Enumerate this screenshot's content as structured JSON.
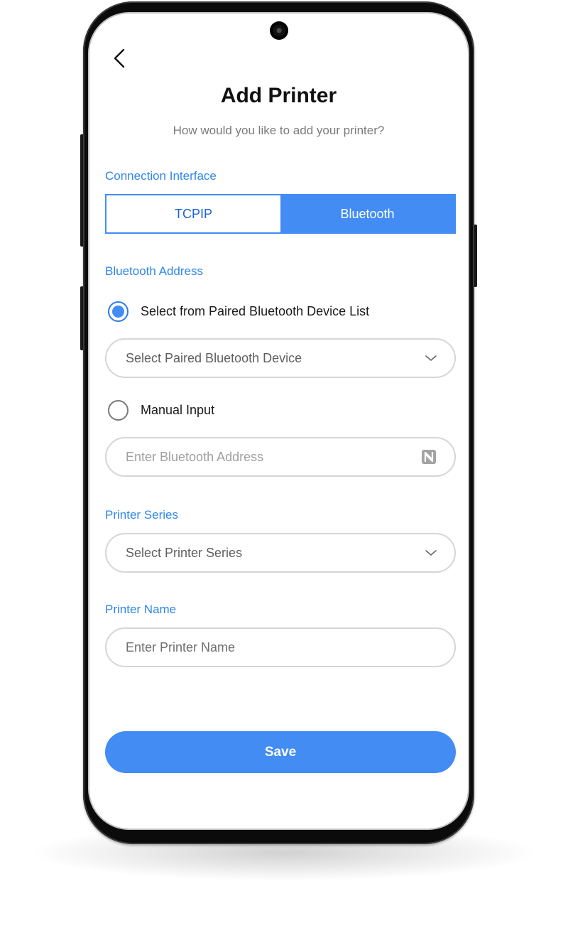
{
  "header": {
    "back_icon": "chevron-left-icon",
    "title": "Add Printer",
    "subtitle": "How would you like to add your printer?"
  },
  "connection": {
    "label": "Connection Interface",
    "options": [
      {
        "label": "TCPIP",
        "selected": false
      },
      {
        "label": "Bluetooth",
        "selected": true
      }
    ]
  },
  "bluetooth": {
    "label": "Bluetooth Address",
    "paired_option": {
      "label": "Select from Paired Bluetooth Device List",
      "checked": true
    },
    "paired_select": {
      "value": "Select Paired Bluetooth Device",
      "icon": "chevron-down-icon"
    },
    "manual_option": {
      "label": "Manual Input",
      "checked": false
    },
    "manual_input": {
      "placeholder": "Enter Bluetooth Address",
      "value": "",
      "icon": "nfc-icon"
    }
  },
  "printer_series": {
    "label": "Printer Series",
    "select": {
      "value": "Select Printer Series",
      "icon": "chevron-down-icon"
    }
  },
  "printer_name": {
    "label": "Printer Name",
    "input": {
      "placeholder": "Enter Printer Name",
      "value": ""
    }
  },
  "actions": {
    "save_label": "Save"
  },
  "colors": {
    "accent": "#428cf4",
    "label_blue": "#2f86ea",
    "title": "#111111"
  }
}
